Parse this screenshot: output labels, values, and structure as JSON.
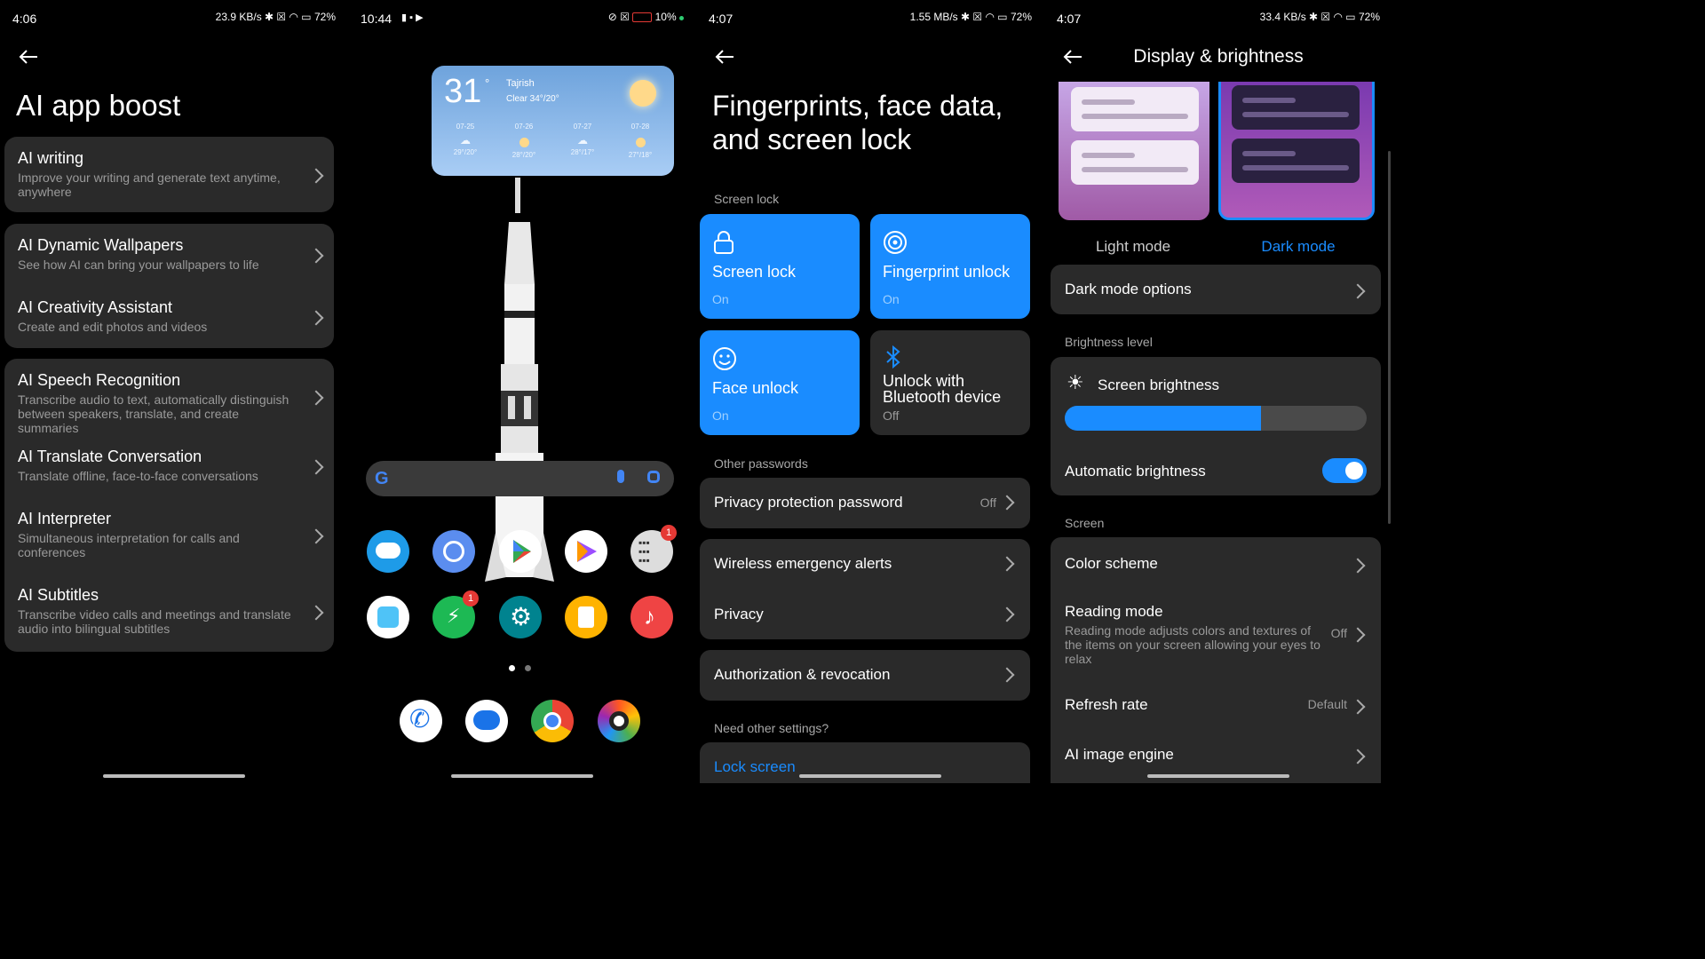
{
  "panel1": {
    "status": {
      "time": "4:06",
      "right": "23.9 KB/s ✱ ☒ ◠ ▭ 72%"
    },
    "title": "AI app boost",
    "items": [
      {
        "title": "AI writing",
        "subtitle": "Improve your writing and generate text anytime, anywhere"
      },
      {
        "title": "AI Dynamic Wallpapers",
        "subtitle": "See how AI can bring your wallpapers to life"
      },
      {
        "title": "AI Creativity Assistant",
        "subtitle": "Create and edit photos and videos"
      },
      {
        "title": "AI Speech Recognition",
        "subtitle": "Transcribe audio to text, automatically distinguish between speakers, translate, and create summaries"
      },
      {
        "title": "AI Translate Conversation",
        "subtitle": "Translate offline, face-to-face conversations"
      },
      {
        "title": "AI Interpreter",
        "subtitle": "Simultaneous interpretation for calls and conferences"
      },
      {
        "title": "AI Subtitles",
        "subtitle": "Transcribe video calls and meetings and translate audio into bilingual subtitles"
      }
    ]
  },
  "panel2": {
    "status": {
      "time": "10:44",
      "right": "10%"
    },
    "weather": {
      "temp": "31",
      "deg": "°",
      "city": "Tajrish",
      "condition": "Clear  34°/20°",
      "days": [
        {
          "date": "07-25",
          "range": "29°/20°",
          "icon": "cloud-rain"
        },
        {
          "date": "07-26",
          "range": "28°/20°",
          "icon": "sun"
        },
        {
          "date": "07-27",
          "range": "28°/17°",
          "icon": "cloud-rain"
        },
        {
          "date": "07-28",
          "range": "27°/18°",
          "icon": "sun"
        }
      ]
    },
    "search_logo": "G",
    "badges": {
      "folder": "1",
      "security": "1"
    },
    "apps_row1": [
      "weather-app",
      "compass-app",
      "play-store",
      "play-games",
      "tools-folder"
    ],
    "apps_row2": [
      "gallery-app",
      "security-app",
      "settings-app",
      "cleaner-app",
      "music-app"
    ],
    "dock": [
      "phone-app",
      "messages-app",
      "chrome-app",
      "camera-app"
    ]
  },
  "panel3": {
    "status": {
      "time": "4:07",
      "right": "1.55 MB/s ✱ ☒ ◠ ▭ 72%"
    },
    "title_line1": "Fingerprints, face data,",
    "title_line2": "and screen lock",
    "section_screen_lock": "Screen lock",
    "tiles": [
      {
        "title": "Screen lock",
        "state": "On",
        "icon": "lock-icon"
      },
      {
        "title": "Fingerprint unlock",
        "state": "On",
        "icon": "fingerprint-icon"
      },
      {
        "title": "Face unlock",
        "state": "On",
        "icon": "face-icon"
      },
      {
        "title_line1": "Unlock with",
        "title_line2": "Bluetooth device",
        "state": "Off",
        "icon": "bluetooth-icon"
      }
    ],
    "section_other": "Other passwords",
    "privacy_password": {
      "label": "Privacy protection password",
      "value": "Off"
    },
    "wireless_alerts": "Wireless emergency alerts",
    "privacy": "Privacy",
    "authorization": "Authorization & revocation",
    "section_need": "Need other settings?",
    "lock_screen_link": "Lock screen"
  },
  "panel4": {
    "status": {
      "time": "4:07",
      "right": "33.4 KB/s ✱ ☒ ◠ ▭ 72%"
    },
    "title": "Display & brightness",
    "light_mode": "Light mode",
    "dark_mode": "Dark mode",
    "dark_mode_options": "Dark mode options",
    "section_brightness": "Brightness level",
    "screen_brightness": "Screen brightness",
    "brightness_level": 0.65,
    "automatic_brightness": "Automatic brightness",
    "auto_brightness_on": true,
    "section_screen": "Screen",
    "color_scheme": "Color scheme",
    "reading_mode": {
      "title": "Reading mode",
      "subtitle": "Reading mode adjusts colors and textures of the items on your screen allowing your eyes to relax",
      "value": "Off"
    },
    "refresh_rate": {
      "title": "Refresh rate",
      "value": "Default"
    },
    "ai_image_engine": "AI image engine"
  },
  "colors": {
    "accent": "#1a8cff",
    "card": "#2a2a2a",
    "background": "#000000"
  }
}
